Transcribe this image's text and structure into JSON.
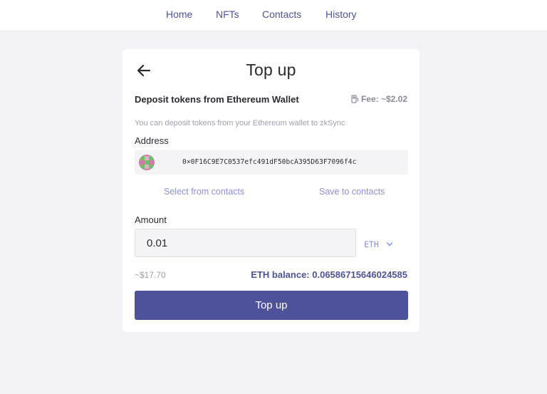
{
  "nav": {
    "items": [
      {
        "label": "Home"
      },
      {
        "label": "NFTs"
      },
      {
        "label": "Contacts"
      },
      {
        "label": "History"
      }
    ]
  },
  "card": {
    "title": "Top up",
    "subtitle": "Deposit tokens from Ethereum Wallet",
    "fee": "Fee: ~$2.02",
    "description": "You can deposit tokens from your Ethereum wallet to zkSync",
    "address_label": "Address",
    "address_value": "0×0F16C9E7C0537efc491dF50bcA395D63F7096f4c",
    "select_contacts": "Select from contacts",
    "save_contacts": "Save to contacts",
    "amount_label": "Amount",
    "amount_value": "0.01",
    "token": "ETH",
    "usd_estimate": "~$17.70",
    "balance": "ETH balance: 0.06586715646024585",
    "submit_label": "Top up"
  },
  "colors": {
    "accent": "#4e529a",
    "link": "#8c8fe0",
    "muted": "#a0a0ae",
    "background": "#f3f3f7"
  },
  "icons": {
    "back": "arrow-left-icon",
    "fee": "fuel-icon",
    "dropdown": "chevron-down-icon",
    "avatar": "identicon"
  }
}
